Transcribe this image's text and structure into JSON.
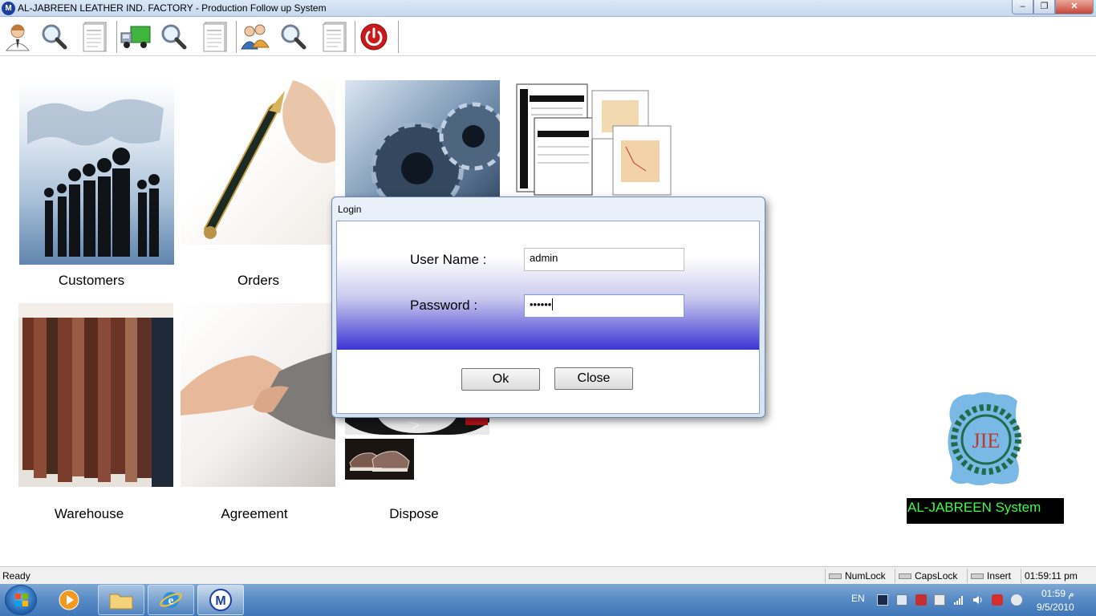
{
  "window": {
    "title": "AL-JABREEN LEATHER IND. FACTORY - Production Follow up System",
    "app_icon_letter": "M",
    "controls": {
      "minimize": "–",
      "maximize": "❐",
      "close": "✕"
    }
  },
  "toolbar": {
    "items": [
      "customer-icon",
      "search-icon",
      "report-icon",
      "truck-icon",
      "search-icon",
      "report-icon",
      "users-icon",
      "search-icon",
      "report-icon",
      "power-icon"
    ]
  },
  "tiles": {
    "customers": "Customers",
    "orders": "Orders",
    "warehouse": "Warehouse",
    "agreement": "Agreement",
    "dispose": "Dispose"
  },
  "login": {
    "title": "Login",
    "username_label": "User Name :",
    "username_value": "admin",
    "password_label": "Password :",
    "password_value": "••••••",
    "ok_label": "Ok",
    "close_label": "Close"
  },
  "logo": {
    "caption": "AL-JABREEN System",
    "caption_color": "#39ff4b"
  },
  "status": {
    "ready": "Ready",
    "numlock": "NumLock",
    "capslock": "CapsLock",
    "insert": "Insert",
    "time": "01:59:11 pm"
  },
  "taskbar": {
    "language": "EN",
    "clock_time": "01:59 م",
    "clock_date": "9/5/2010"
  }
}
